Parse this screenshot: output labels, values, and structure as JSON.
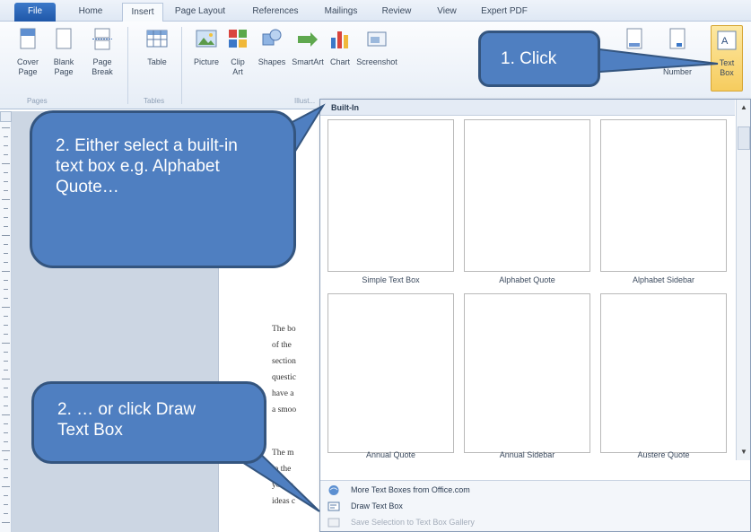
{
  "tabs": [
    "File",
    "Home",
    "Insert",
    "Page Layout",
    "References",
    "Mailings",
    "Review",
    "View",
    "Expert PDF"
  ],
  "ribbon": {
    "buttons": {
      "cover_page": "Cover Page",
      "blank_page": "Blank Page",
      "page_break": "Page Break",
      "table": "Table",
      "picture": "Picture",
      "clip_art": "Clip Art",
      "shapes": "Shapes",
      "smartart": "SmartArt",
      "chart": "Chart",
      "screenshot": "Screenshot",
      "footer": "Footer",
      "page_number": "Page Number",
      "text_box": "Text Box"
    },
    "groups": {
      "pages": "Pages",
      "tables": "Tables",
      "illustrations": "Illust..."
    }
  },
  "dropdown": {
    "header": "Built-In",
    "items": [
      "Simple Text Box",
      "Alphabet Quote",
      "Alphabet Sidebar",
      "Annual Quote",
      "Annual Sidebar",
      "Austere Quote"
    ],
    "menu": {
      "more": "More Text Boxes from Office.com",
      "draw": "Draw Text Box",
      "save": "Save Selection to Text Box Gallery"
    }
  },
  "document": {
    "lines": [
      "The bo",
      "of the",
      "section",
      "questic",
      "have a",
      "a smoo",
      "The m",
      "in the",
      "you to",
      "ideas c"
    ]
  },
  "callouts": {
    "one": "1. Click",
    "two": "2. Either select a built-in text box e.g. Alphabet Quote…",
    "three": "2. … or click Draw Text Box"
  },
  "colors": {
    "callout_fill": "#4f7fc1",
    "callout_border": "#34557f",
    "file_tab": "#2a64b5"
  }
}
